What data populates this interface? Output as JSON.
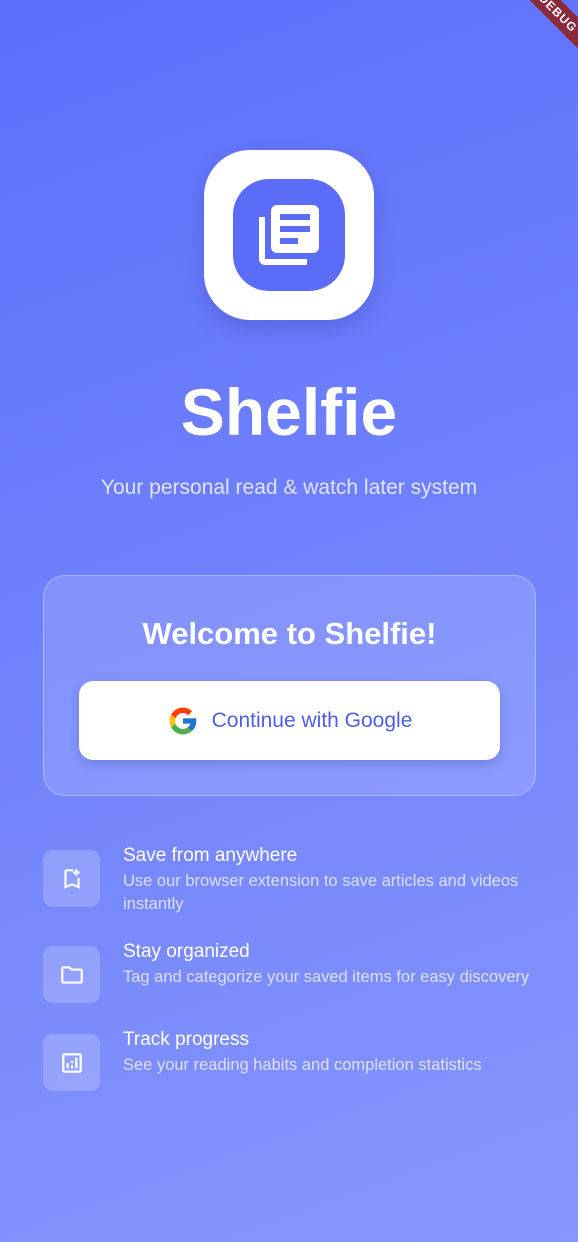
{
  "debug_banner": "DEBUG",
  "app": {
    "title": "Shelfie",
    "tagline": "Your personal read & watch later system",
    "logo_icon": "library-books-icon",
    "brand_color": "#5b6cf6"
  },
  "login_card": {
    "title": "Welcome to Shelfie!",
    "google_button_label": "Continue with Google",
    "google_icon": "google-g-icon"
  },
  "features": [
    {
      "icon": "bookmark-add-icon",
      "title": "Save from anywhere",
      "description": "Use our browser extension to save articles and videos instantly"
    },
    {
      "icon": "folder-icon",
      "title": "Stay organized",
      "description": "Tag and categorize your saved items for easy discovery"
    },
    {
      "icon": "analytics-icon",
      "title": "Track progress",
      "description": "See your reading habits and completion statistics"
    }
  ]
}
